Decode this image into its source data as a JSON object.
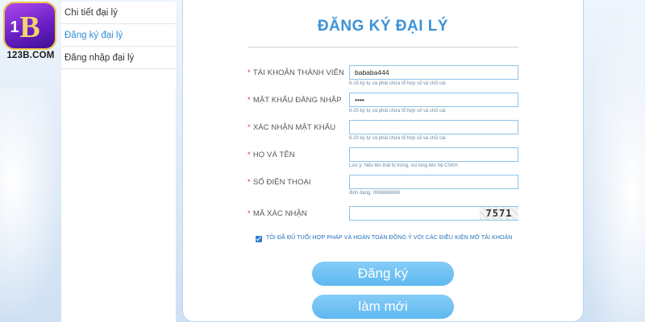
{
  "logo": {
    "text": "123B.COM"
  },
  "sidebar": {
    "items": [
      {
        "label": "Chi tiết đại lý",
        "active": false
      },
      {
        "label": "Đăng ký đại lý",
        "active": true
      },
      {
        "label": "Đăng nhập đại lý",
        "active": false
      }
    ]
  },
  "form": {
    "title": "ĐĂNG KÝ ĐẠI LÝ",
    "required_mark": "*",
    "username": {
      "label": "TÀI KHOẢN THÀNH VIÊN",
      "value": "bababa444",
      "hint": "6-15 ký tự và phải chứa tổ hợp số và chữ cái"
    },
    "password": {
      "label": "MẬT KHẨU ĐĂNG NHẬP",
      "value": "••••",
      "hint": "6-20 ký tự và phải chứa tổ hợp số và chữ cái"
    },
    "confirm_password": {
      "label": "XÁC NHẬN MẬT KHẨU",
      "value": "",
      "hint": "6-20 ký tự và phải chứa tổ hợp số và chữ cái"
    },
    "fullname": {
      "label": "HỌ VÀ TÊN",
      "value": "",
      "hint": "Lưu ý: Nếu tên thật bị trùng, vui lòng liên hệ CSKH"
    },
    "phone": {
      "label": "SỐ ĐIỆN THOẠI",
      "value": "",
      "hint": "định dạng: 0988888888"
    },
    "captcha": {
      "label": "MÃ XÁC NHẬN",
      "value": "",
      "code": "7571"
    },
    "agree": {
      "checked": true,
      "text": "TÔI ĐÃ ĐỦ TUỔI HỢP PHÁP VÀ HOÀN TOÀN ĐỒNG Ý VỚI CÁC ĐIỀU KIỆN MỞ TÀI KHOẢN"
    },
    "submit_label": "Đăng ký",
    "reset_label": "làm mới"
  },
  "colors": {
    "accent": "#3c92d6",
    "button": "#6cc0f2",
    "required": "#e23333",
    "logo": "#6a1fc7"
  },
  "icons": {
    "logo": "123b-logo-icon",
    "check": "checkbox-check-icon"
  }
}
